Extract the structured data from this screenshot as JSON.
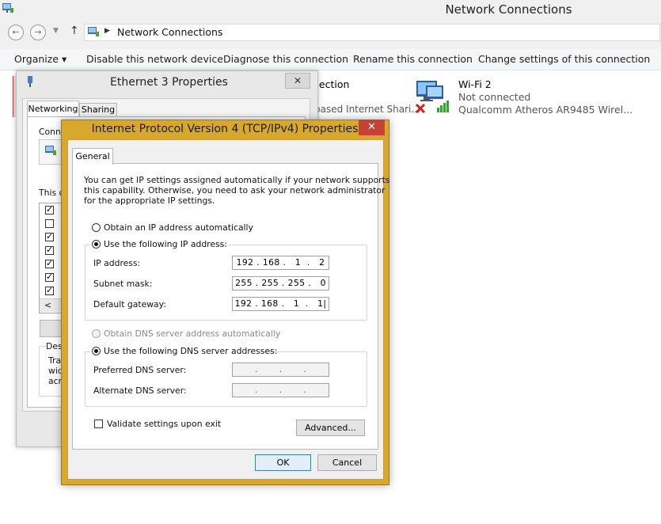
{
  "window": {
    "title": "Network Connections"
  },
  "address": {
    "path": "Network Connections"
  },
  "commands": {
    "organize": "Organize ▾",
    "disable": "Disable this network device",
    "diagnose": "Diagnose this connection",
    "rename": "Rename this connection",
    "change": "Change settings of this connection"
  },
  "connections": {
    "partial_name": "nection",
    "partial_sub": "based Internet Shari...",
    "wifi": {
      "name": "Wi-Fi 2",
      "status": "Not connected",
      "adapter": "Qualcomm Atheros AR9485 Wirel..."
    }
  },
  "ethernet": {
    "title": "Ethernet 3 Properties",
    "tabs": [
      "Networking",
      "Sharing"
    ],
    "conn_label": "Conne",
    "this_label": "This c",
    "desc_label": "Des",
    "desc_lines": [
      "Tra",
      "wid",
      "acr"
    ],
    "scroll_left": "<"
  },
  "ipv4": {
    "title": "Internet Protocol Version 4 (TCP/IPv4) Properties",
    "close": "✕",
    "tab": "General",
    "description": [
      "You can get IP settings assigned automatically if your network supports",
      "this capability. Otherwise, you need to ask your network administrator",
      "for the appropriate IP settings."
    ],
    "obtain_ip_auto": "Obtain an IP address automatically",
    "use_ip": "Use the following IP address:",
    "ip_label": "IP address:",
    "ip_value": "192 . 168 .   1  .   2",
    "subnet_label": "Subnet mask:",
    "subnet_value": "255 . 255 . 255 .   0",
    "gateway_label": "Default gateway:",
    "gateway_value": "192 . 168 .   1  .   1|",
    "obtain_dns_auto": "Obtain DNS server address automatically",
    "use_dns": "Use the following DNS server addresses:",
    "preferred_label": "Preferred DNS server:",
    "preferred_value": ".       .       .",
    "alternate_label": "Alternate DNS server:",
    "alternate_value": ".       .       .",
    "validate": "Validate settings upon exit",
    "advanced": "Advanced...",
    "ok": "OK",
    "cancel": "Cancel"
  },
  "colors": {
    "accent": "#d7a82c",
    "close": "#c74134"
  }
}
